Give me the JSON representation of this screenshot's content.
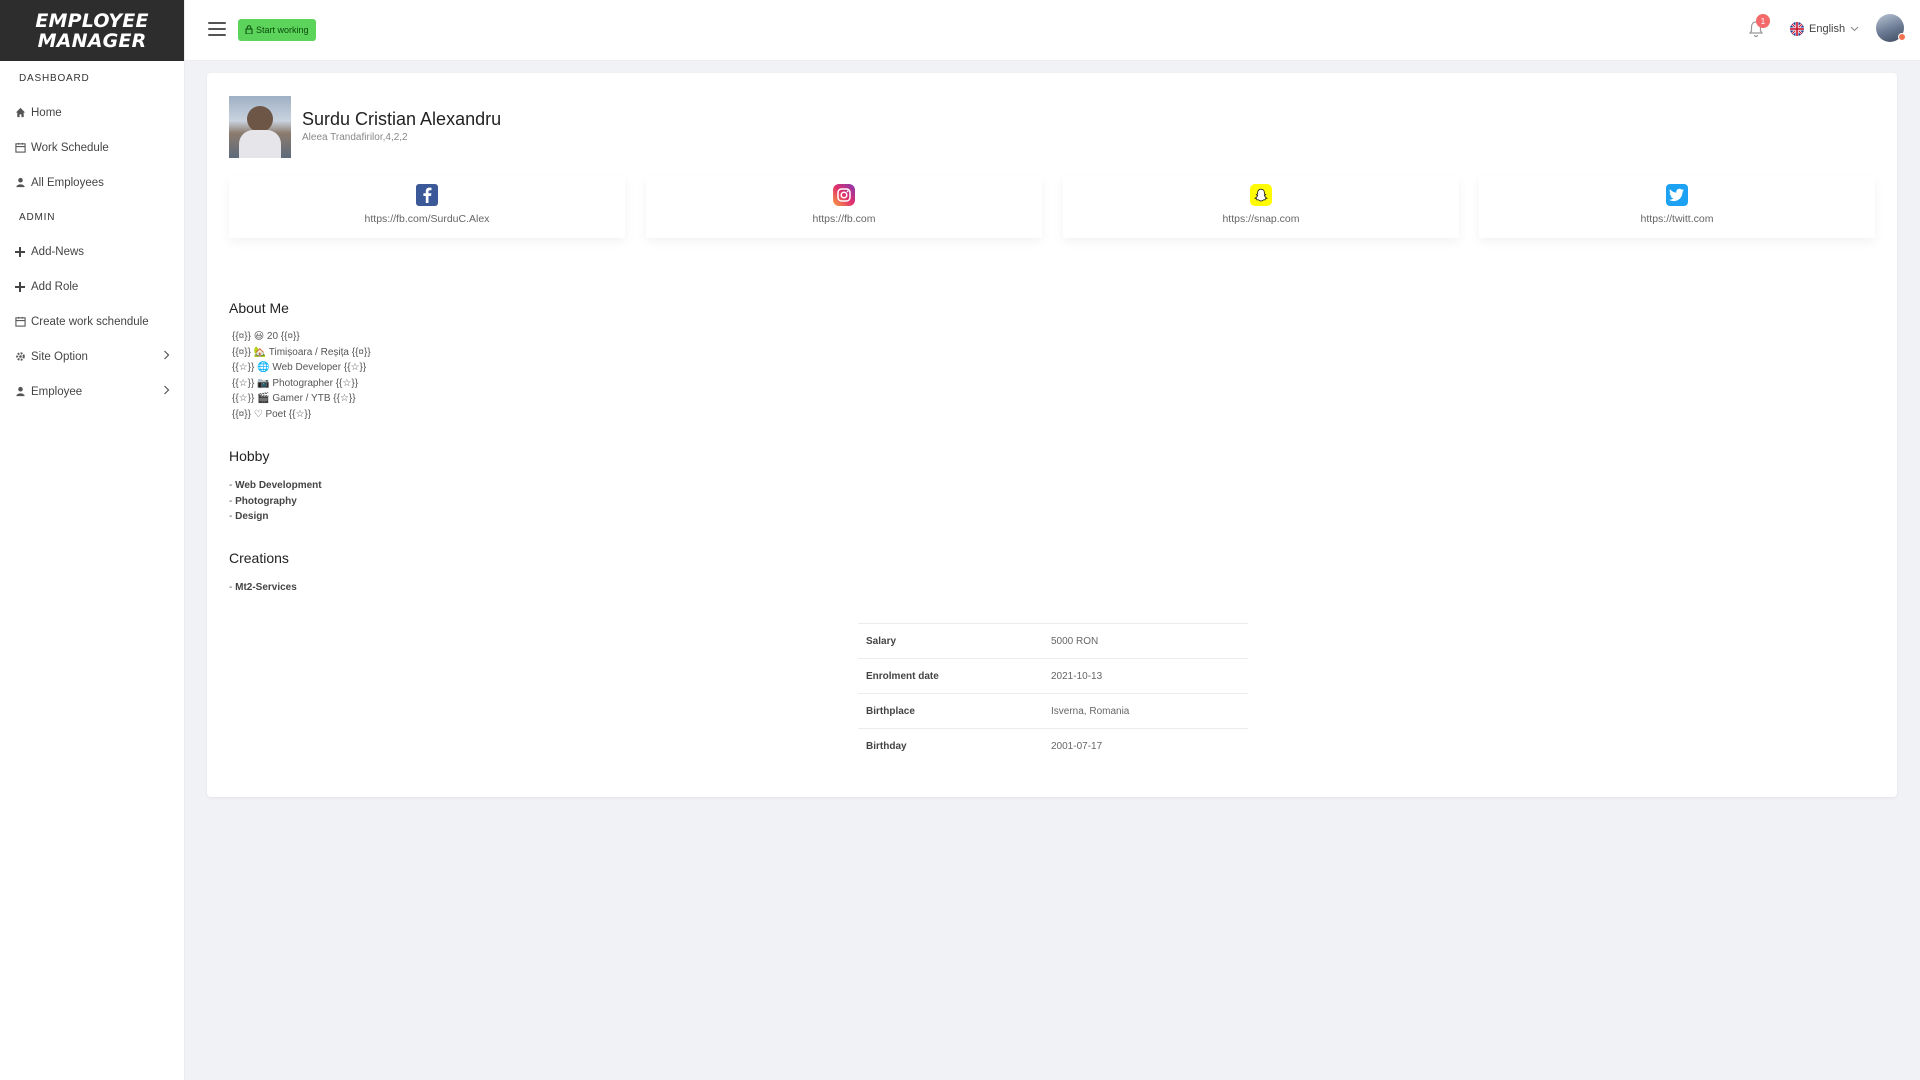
{
  "brand": {
    "line1": "EMPLOYEE",
    "line2": "MANAGER"
  },
  "sidebar": {
    "sections": [
      {
        "title": "DASHBOARD",
        "items": [
          {
            "label": "Home",
            "icon": "home-icon"
          },
          {
            "label": "Work Schedule",
            "icon": "calendar-icon"
          },
          {
            "label": "All Employees",
            "icon": "user-icon"
          }
        ]
      },
      {
        "title": "ADMIN",
        "items": [
          {
            "label": "Add-News",
            "icon": "plus-icon"
          },
          {
            "label": "Add Role",
            "icon": "plus-icon"
          },
          {
            "label": "Create work schendule",
            "icon": "calendar-icon"
          },
          {
            "label": "Site Option",
            "icon": "gear-icon",
            "submenu": true
          },
          {
            "label": "Employee",
            "icon": "user-icon",
            "submenu": true
          }
        ]
      }
    ]
  },
  "header": {
    "start_label": "Start working",
    "notification_count": "1",
    "language": "English"
  },
  "profile": {
    "name": "Surdu Cristian Alexandru",
    "address": "Aleea Trandafirilor,4,2,2"
  },
  "socials": [
    {
      "name": "facebook",
      "url": "https://fb.com/SurduC.Alex",
      "color": "#3b5998"
    },
    {
      "name": "instagram",
      "url": "https://fb.com",
      "color": "#e1306c"
    },
    {
      "name": "snapchat",
      "url": "https://snap.com",
      "color": "#fffc00"
    },
    {
      "name": "twitter",
      "url": "https://twitt.com",
      "color": "#1da1f2"
    }
  ],
  "about": {
    "title": "About Me",
    "lines": [
      "{{¤}} 😃 20 {{¤}}",
      "{{¤}} 🏡 Timișoara / Reșița {{¤}}",
      "{{☆}} 🌐 Web Developer {{☆}}",
      "{{☆}} 📷 Photographer {{☆}}",
      "{{☆}} 🎬 Gamer / YTB {{☆}}",
      "{{¤}} ♡ Poet {{☆}}"
    ]
  },
  "hobby": {
    "title": "Hobby",
    "items": [
      "Web Development",
      "Photography",
      "Design"
    ]
  },
  "creations": {
    "title": "Creations",
    "items": [
      "Mt2-Services"
    ]
  },
  "info": [
    {
      "key": "Salary",
      "value": "5000 RON"
    },
    {
      "key": "Enrolment date",
      "value": "2021-10-13"
    },
    {
      "key": "Birthplace",
      "value": "Isverna, Romania"
    },
    {
      "key": "Birthday",
      "value": "2001-07-17"
    }
  ]
}
